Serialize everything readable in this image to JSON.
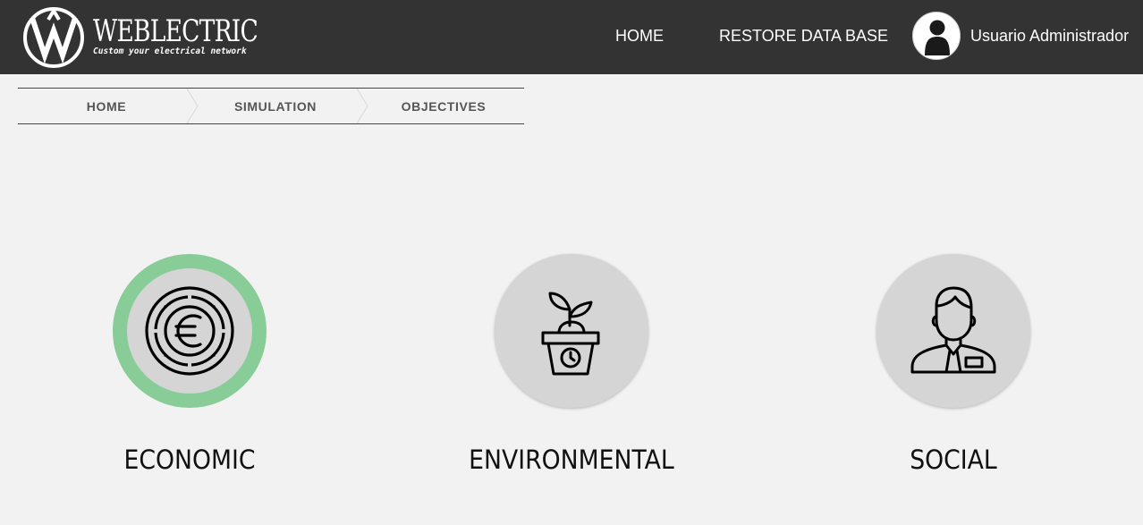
{
  "header": {
    "logo_title": "WEBLECTRIC",
    "logo_tagline": "Custom your electrical network",
    "nav": {
      "home_label": "HOME",
      "restore_label": "RESTORE DATA BASE"
    },
    "user_name": "Usuario Administrador"
  },
  "breadcrumb": {
    "items": [
      "HOME",
      "SIMULATION",
      "OBJECTIVES"
    ]
  },
  "objectives": [
    {
      "label": "ECONOMIC",
      "icon": "euro-coin-icon",
      "selected": true
    },
    {
      "label": "ENVIRONMENTAL",
      "icon": "plant-pot-icon",
      "selected": false
    },
    {
      "label": "SOCIAL",
      "icon": "person-icon",
      "selected": false
    }
  ],
  "colors": {
    "topbar": "#333333",
    "background": "#f2f2f2",
    "selected_ring": "#88cc98",
    "circle_fill": "#d5d5d5"
  }
}
